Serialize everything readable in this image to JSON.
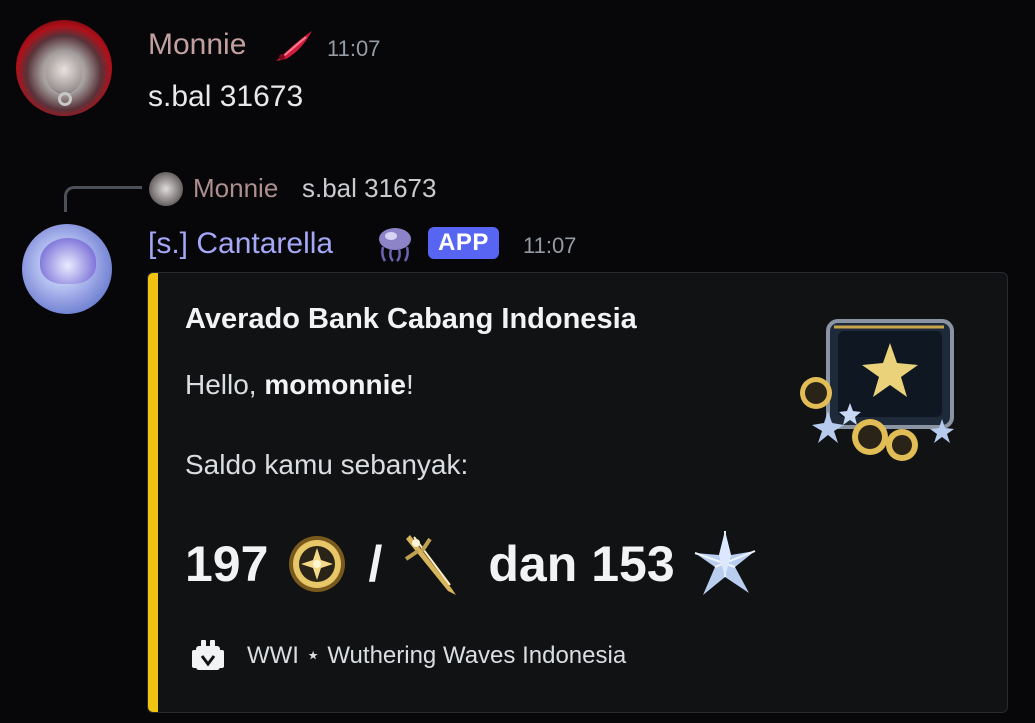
{
  "message1": {
    "username": "Monnie",
    "username_color": "#c3a0a0",
    "decoration_icon": "feather-icon",
    "timestamp": "11:07",
    "content": "s.bal 31673"
  },
  "reply": {
    "username": "Monnie",
    "content": "s.bal 31673"
  },
  "message2": {
    "username": "[s.] Cantarella",
    "username_color": "#a5a8f7",
    "decoration_icon": "jellyfish-icon",
    "badge": "APP",
    "badge_color": "#5865f2",
    "timestamp": "11:07"
  },
  "embed": {
    "accent_color": "#f1c40f",
    "title": "Averado Bank Cabang Indonesia",
    "greeting_prefix": "Hello, ",
    "greeting_name": "momonnie",
    "greeting_suffix": "!",
    "balance_label": "Saldo kamu sebanyak:",
    "coin_amount": "197",
    "separator": "/",
    "conjunction": "dan",
    "crystal_amount": "153",
    "coin_icon": "shell-credit-icon",
    "sword_icon": "sword-icon",
    "crystal_icon": "star-crystal-icon",
    "thumbnail_icon": "treasure-chest-icon",
    "footer_icon": "server-logo-icon",
    "footer_text": "WWI ⋆ Wuthering Waves Indonesia"
  }
}
